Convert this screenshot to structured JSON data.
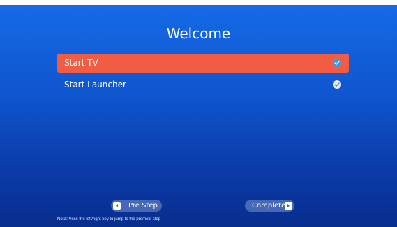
{
  "screen": {
    "title": "Welcome"
  },
  "options": [
    {
      "label": "Start TV",
      "selected": true,
      "icon": "checkmark-icon"
    },
    {
      "label": "Start Launcher",
      "selected": false,
      "icon": "checkmark-icon"
    }
  ],
  "navigation": {
    "pre_step_label": "Pre Step",
    "pre_step_icon": "arrow-left-icon",
    "complete_label": "Complete",
    "complete_icon": "arrow-right-icon"
  },
  "note": "Note:Press the left/right key to jump to the pre/next step",
  "colors": {
    "background_top": "#1669e6",
    "background_bottom": "#082e8e",
    "selected_option": "#f25c43",
    "check_selected": "#2aa0ff",
    "check_unselected": "#e6ebf5"
  }
}
